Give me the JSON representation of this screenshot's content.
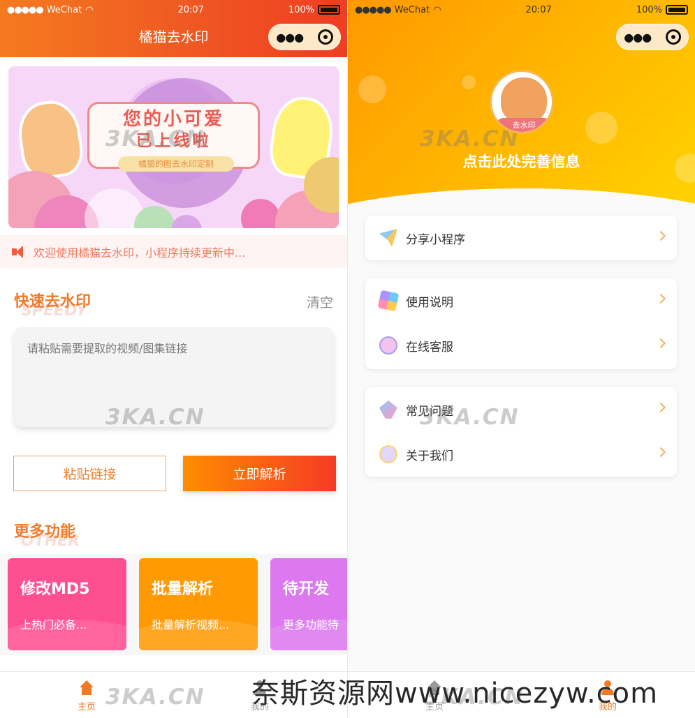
{
  "status": {
    "carrier": "WeChat",
    "time": "20:07",
    "battery": "100%"
  },
  "left": {
    "title": "橘猫去水印",
    "banner": {
      "line1": "您的小可爱",
      "line2": "已上线啦",
      "line3": "橘猫的图去水印定制"
    },
    "notice": "欢迎使用橘猫去水印，小程序持续更新中...",
    "quick": {
      "title": "快速去水印",
      "ghost": "SPEEDY",
      "clear": "清空",
      "placeholder": "请粘贴需要提取的视频/图集链接"
    },
    "buttons": {
      "paste": "粘贴链接",
      "parse": "立即解析"
    },
    "more": {
      "title": "更多功能",
      "ghost": "OTHER",
      "cards": [
        {
          "title": "修改MD5",
          "subtitle": "上热门必备..."
        },
        {
          "title": "批量解析",
          "subtitle": "批量解析视频..."
        },
        {
          "title": "待开发",
          "subtitle": "更多功能待"
        }
      ]
    },
    "tabs": {
      "home": "主页",
      "mine": "我的"
    }
  },
  "right": {
    "avatar_label": "去水印",
    "complete_info": "点击此处完善信息",
    "groups": [
      {
        "items": [
          {
            "label": "分享小程序",
            "icon": "paper-plane-icon"
          }
        ]
      },
      {
        "items": [
          {
            "label": "使用说明",
            "icon": "pinwheel-icon"
          },
          {
            "label": "在线客服",
            "icon": "customer-service-icon"
          }
        ]
      },
      {
        "items": [
          {
            "label": "常见问题",
            "icon": "question-kite-icon"
          },
          {
            "label": "关于我们",
            "icon": "about-icon"
          }
        ]
      }
    ],
    "tabs": {
      "home": "主页",
      "mine": "我的"
    }
  },
  "watermarks": {
    "site": "3KA.CN",
    "footer": "奈斯资源网www.nicezyw.com"
  },
  "colors": {
    "primary_orange": "#f57a1f",
    "red_orange": "#ef3d22",
    "yellow": "#ffd200",
    "pink_card": "#ff4f93",
    "orange_card": "#ff9a05",
    "purple_card": "#dc79f0"
  }
}
